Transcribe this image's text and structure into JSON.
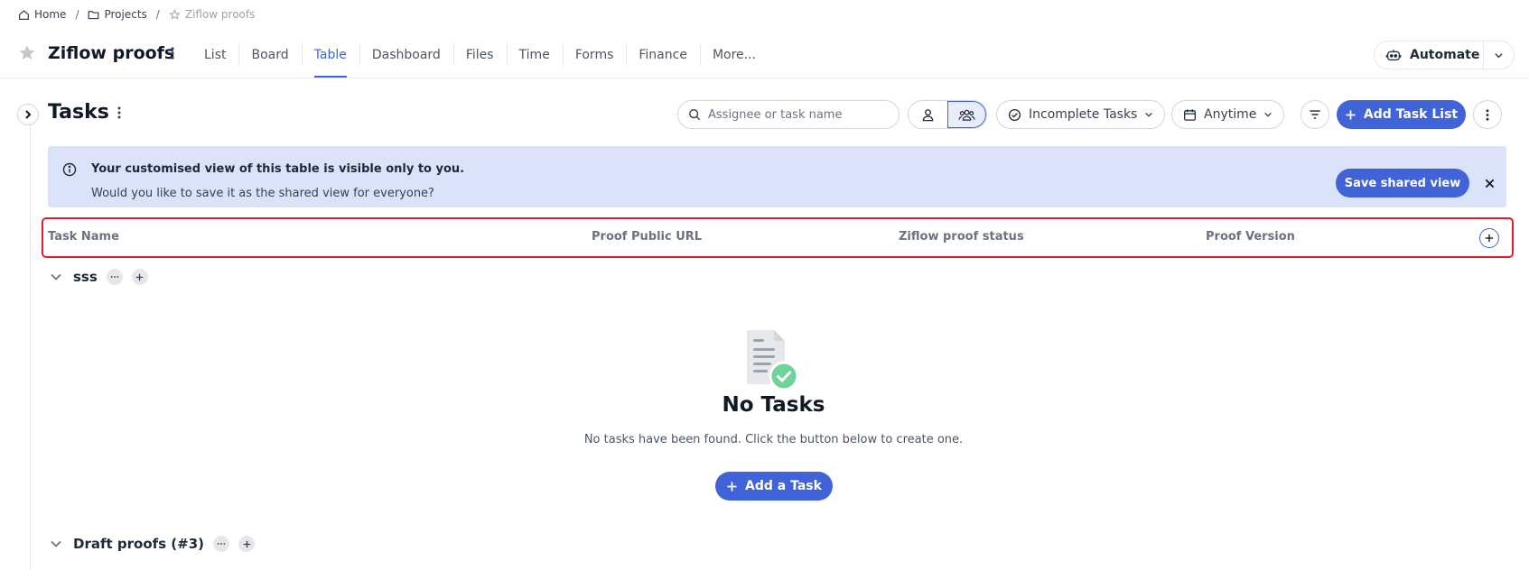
{
  "breadcrumb": {
    "home": "Home",
    "projects": "Projects",
    "current": "Ziflow proofs",
    "separator": "/"
  },
  "project": {
    "title": "Ziflow proofs",
    "tabs": [
      {
        "label": "List",
        "active": false
      },
      {
        "label": "Board",
        "active": false
      },
      {
        "label": "Table",
        "active": true
      },
      {
        "label": "Dashboard",
        "active": false
      },
      {
        "label": "Files",
        "active": false
      },
      {
        "label": "Time",
        "active": false
      },
      {
        "label": "Forms",
        "active": false
      },
      {
        "label": "Finance",
        "active": false
      },
      {
        "label": "More...",
        "active": false
      }
    ],
    "automate_label": "Automate"
  },
  "tasks": {
    "title": "Tasks",
    "search_placeholder": "Assignee or task name",
    "status_filter": "Incomplete Tasks",
    "date_filter": "Anytime",
    "add_list_label": "Add Task List"
  },
  "banner": {
    "line1": "Your customised view of this table is visible only to you.",
    "line2": "Would you like to save it as the shared view for everyone?",
    "save_label": "Save shared view"
  },
  "table": {
    "columns": [
      "Task Name",
      "Proof Public URL",
      "Ziflow proof status",
      "Proof Version"
    ]
  },
  "groups": [
    {
      "name": "sss"
    },
    {
      "name": "Draft proofs (#3)"
    }
  ],
  "empty": {
    "title": "No Tasks",
    "description": "No tasks have been found. Click the button below to create one.",
    "add_label": "Add a Task"
  },
  "colors": {
    "accent": "#4064d8",
    "banner_bg": "#dbe3fb",
    "highlight_border": "#e11d2e",
    "success": "#6fd39a"
  }
}
